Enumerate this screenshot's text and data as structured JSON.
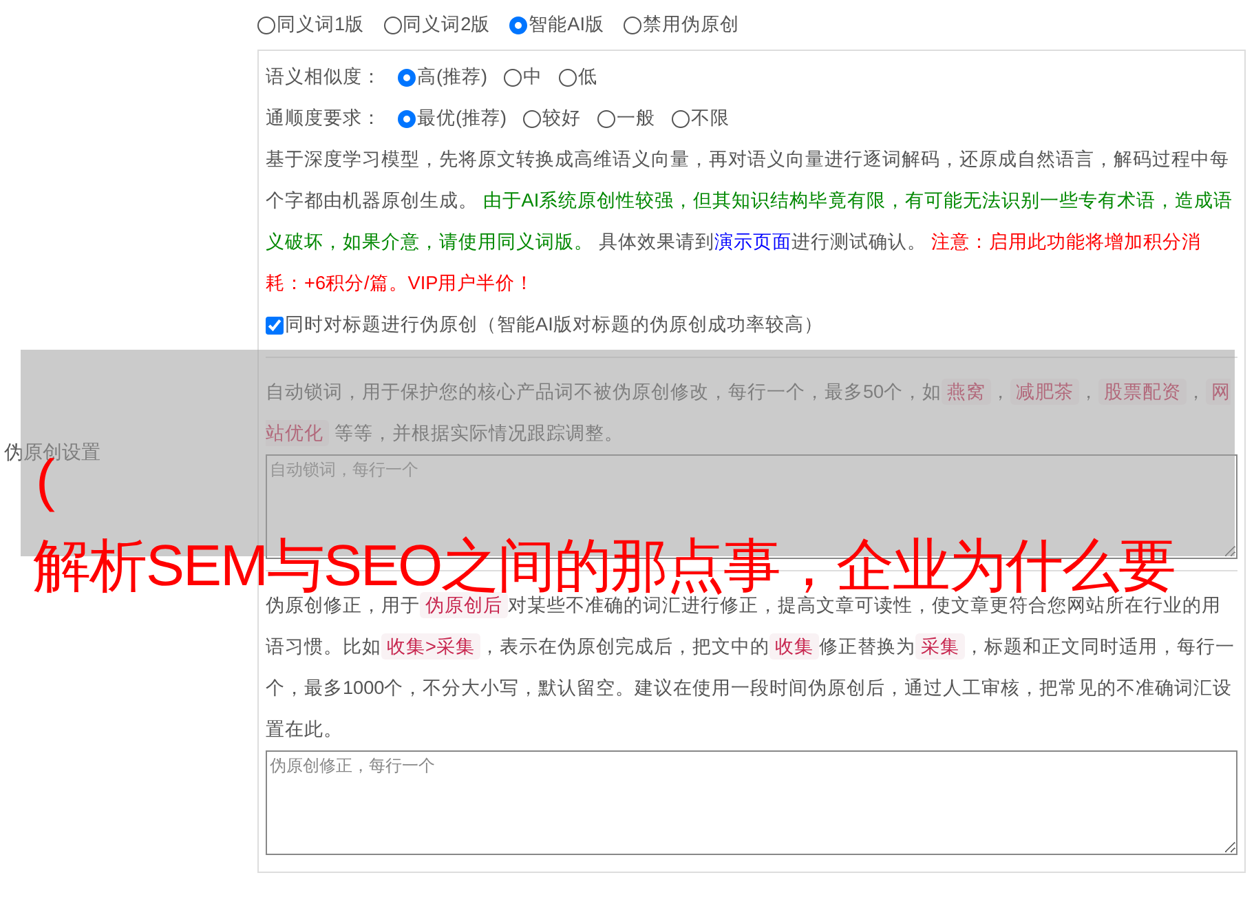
{
  "mode_options": [
    {
      "label": "同义词1版",
      "selected": false
    },
    {
      "label": "同义词2版",
      "selected": false
    },
    {
      "label": "智能AI版",
      "selected": true
    },
    {
      "label": "禁用伪原创",
      "selected": false
    }
  ],
  "side_label": "伪原创设置",
  "ai_settings": {
    "similarity": {
      "label": "语义相似度：",
      "options": [
        {
          "label": "高(推荐)",
          "selected": true
        },
        {
          "label": "中",
          "selected": false
        },
        {
          "label": "低",
          "selected": false
        }
      ]
    },
    "fluency": {
      "label": "通顺度要求：",
      "options": [
        {
          "label": "最优(推荐)",
          "selected": true
        },
        {
          "label": "较好",
          "selected": false
        },
        {
          "label": "一般",
          "selected": false
        },
        {
          "label": "不限",
          "selected": false
        }
      ]
    },
    "description": [
      {
        "kind": "text",
        "text": "基于深度学习模型，先将原文转换成高维语义向量，再对语义向量进行逐词解码，还原成自然语言，解码过程中每个字都由机器原创生成。 "
      },
      {
        "kind": "note",
        "text": "由于AI系统原创性较强，但其知识结构毕竟有限，有可能无法识别一些专有术语，造成语义破坏，如果介意，请使用同义词版。"
      },
      {
        "kind": "text",
        "text": " 具体效果请到"
      },
      {
        "kind": "link",
        "text": "演示页面"
      },
      {
        "kind": "text",
        "text": "进行测试确认。 "
      },
      {
        "kind": "warning",
        "text": "注意：启用此功能将增加积分消耗：+6积分/篇。VIP用户半价！"
      }
    ],
    "title_checkbox": {
      "label": "同时对标题进行伪原创（智能AI版对标题的伪原创成功率较高）",
      "checked": true
    }
  },
  "lock_words": {
    "description": [
      {
        "kind": "text",
        "text": "自动锁词，用于保护您的核心产品词不被伪原创修改，每行一个，最多50个，如"
      },
      {
        "kind": "tag",
        "text": "燕窝"
      },
      {
        "kind": "text",
        "text": "，"
      },
      {
        "kind": "tag",
        "text": "减肥茶"
      },
      {
        "kind": "text",
        "text": "，"
      },
      {
        "kind": "tag",
        "text": "股票配资"
      },
      {
        "kind": "text",
        "text": "，"
      },
      {
        "kind": "tag",
        "text": "网站优化"
      },
      {
        "kind": "text",
        "text": " 等等，并根据实际情况跟踪调整。"
      }
    ],
    "placeholder": "自动锁词，每行一个"
  },
  "corrections": {
    "description": [
      {
        "kind": "text",
        "text": "伪原创修正，用于"
      },
      {
        "kind": "tag",
        "text": "伪原创后"
      },
      {
        "kind": "text",
        "text": "对某些不准确的词汇进行修正，提高文章可读性，使文章更符合您网站所在行业的用语习惯。比如"
      },
      {
        "kind": "tag",
        "text": "收集>采集"
      },
      {
        "kind": "text",
        "text": "，表示在伪原创完成后，把文中的"
      },
      {
        "kind": "tag",
        "text": "收集"
      },
      {
        "kind": "text",
        "text": "修正替换为"
      },
      {
        "kind": "tag",
        "text": "采集"
      },
      {
        "kind": "text",
        "text": "，标题和正文同时适用，每行一个，最多1000个，不分大小写，默认留空。建议在使用一段时间伪原创后，通过人工审核，把常见的不准确词汇设置在此。"
      }
    ],
    "placeholder": "伪原创修正，每行一个"
  },
  "overlay": {
    "mark": "(",
    "headline": "解析SEM与SEO之间的那点事，企业为什么要"
  }
}
